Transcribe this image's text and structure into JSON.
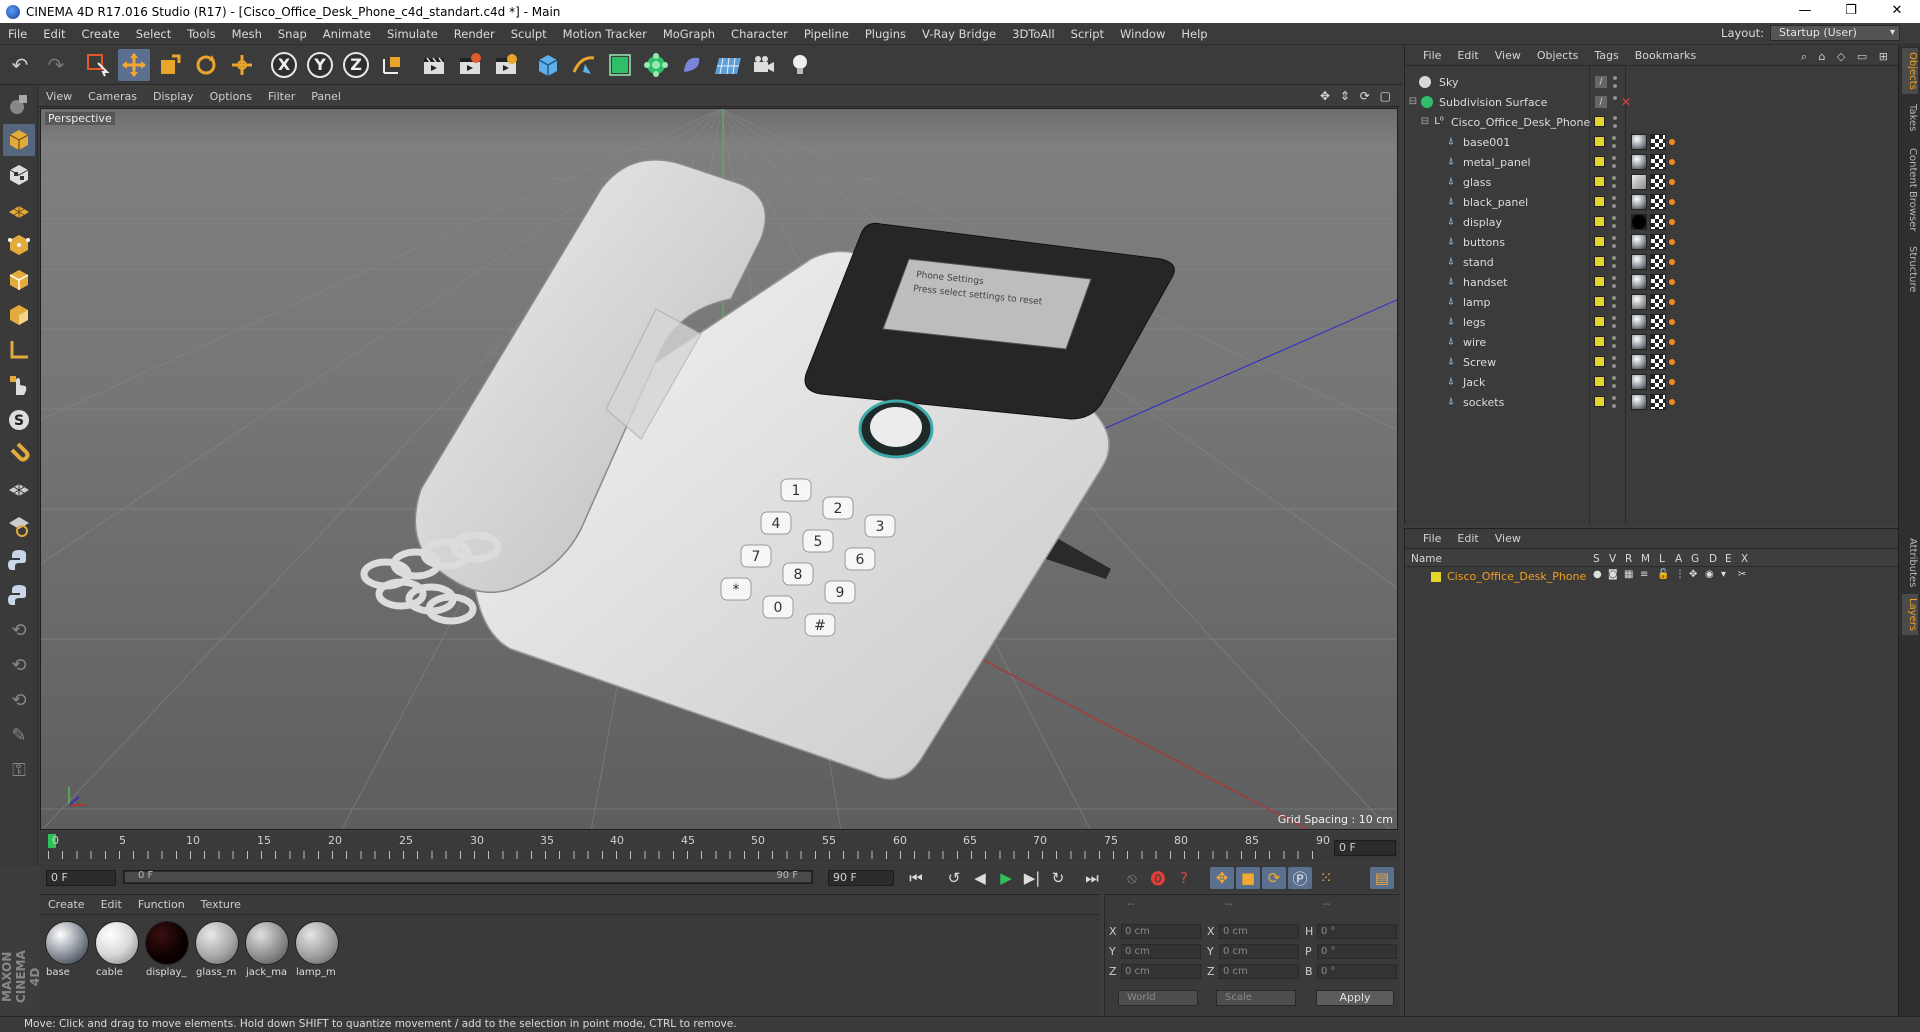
{
  "window": {
    "title": "CINEMA 4D R17.016 Studio (R17) - [Cisco_Office_Desk_Phone_c4d_standart.c4d *] - Main",
    "minimize": "—",
    "maximize": "❐",
    "close": "✕"
  },
  "menu": [
    "File",
    "Edit",
    "Create",
    "Select",
    "Tools",
    "Mesh",
    "Snap",
    "Animate",
    "Simulate",
    "Render",
    "Sculpt",
    "Motion Tracker",
    "MoGraph",
    "Character",
    "Pipeline",
    "Plugins",
    "V-Ray Bridge",
    "3DToAll",
    "Script",
    "Window",
    "Help"
  ],
  "layout": {
    "label": "Layout:",
    "value": "Startup (User)"
  },
  "toolbar": {
    "axis_x": "X",
    "axis_y": "Y",
    "axis_z": "Z"
  },
  "viewport": {
    "menu": [
      "View",
      "Cameras",
      "Display",
      "Options",
      "Filter",
      "Panel"
    ],
    "camera_label": "Perspective",
    "grid_spacing": "Grid Spacing : 10 cm",
    "phone_screen_lines": [
      "Phone Settings",
      "Press select settings to reset"
    ],
    "keys": [
      "1",
      "2",
      "3",
      "4",
      "5",
      "6",
      "7",
      "8",
      "9",
      "*",
      "0",
      "#"
    ]
  },
  "timeline": {
    "ticks": [
      "0",
      "5",
      "10",
      "15",
      "20",
      "25",
      "30",
      "35",
      "40",
      "45",
      "50",
      "55",
      "60",
      "65",
      "70",
      "75",
      "80",
      "85",
      "90"
    ],
    "current_frame": "0 F",
    "start_frame": "0 F",
    "slider_start": "0 F",
    "slider_end": "90 F",
    "end_frame": "90 F"
  },
  "materials": {
    "menu": [
      "Create",
      "Edit",
      "Function",
      "Texture"
    ],
    "items": [
      {
        "name": "base",
        "color": "#9aa0a8"
      },
      {
        "name": "cable",
        "color": "#d9d9d9"
      },
      {
        "name": "display_",
        "color": "#0a0000"
      },
      {
        "name": "glass_m",
        "color": "#a8a8a8"
      },
      {
        "name": "jack_ma",
        "color": "#8e8e8e"
      },
      {
        "name": "lamp_m",
        "color": "#a0a0a0"
      }
    ]
  },
  "coords": {
    "header": [
      "--",
      "--",
      "--"
    ],
    "rows": [
      {
        "a1": "X",
        "v1": "0 cm",
        "a2": "X",
        "v2": "0 cm",
        "a3": "H",
        "v3": "0 °"
      },
      {
        "a1": "Y",
        "v1": "0 cm",
        "a2": "Y",
        "v2": "0 cm",
        "a3": "P",
        "v3": "0 °"
      },
      {
        "a1": "Z",
        "v1": "0 cm",
        "a2": "Z",
        "v2": "0 cm",
        "a3": "B",
        "v3": "0 °"
      }
    ],
    "world": "World",
    "scale": "Scale",
    "apply": "Apply"
  },
  "object_manager": {
    "menu": [
      "File",
      "Edit",
      "View",
      "Objects",
      "Tags",
      "Bookmarks"
    ],
    "objects": [
      {
        "name": "Sky",
        "level": 0,
        "type": "sky"
      },
      {
        "name": "Subdivision Surface",
        "level": 0,
        "type": "subdiv"
      },
      {
        "name": "Cisco_Office_Desk_Phone",
        "level": 1,
        "type": "null"
      },
      {
        "name": "base001",
        "level": 2,
        "type": "poly"
      },
      {
        "name": "metal_panel",
        "level": 2,
        "type": "poly"
      },
      {
        "name": "glass",
        "level": 2,
        "type": "poly"
      },
      {
        "name": "black_panel",
        "level": 2,
        "type": "poly"
      },
      {
        "name": "display",
        "level": 2,
        "type": "poly"
      },
      {
        "name": "buttons",
        "level": 2,
        "type": "poly"
      },
      {
        "name": "stand",
        "level": 2,
        "type": "poly"
      },
      {
        "name": "handset",
        "level": 2,
        "type": "poly"
      },
      {
        "name": "lamp",
        "level": 2,
        "type": "poly"
      },
      {
        "name": "legs",
        "level": 2,
        "type": "poly"
      },
      {
        "name": "wire",
        "level": 2,
        "type": "poly"
      },
      {
        "name": "Screw",
        "level": 2,
        "type": "poly"
      },
      {
        "name": "Jack",
        "level": 2,
        "type": "poly"
      },
      {
        "name": "sockets",
        "level": 2,
        "type": "poly"
      }
    ]
  },
  "layer_manager": {
    "menu": [
      "File",
      "Edit",
      "View"
    ],
    "columns": [
      "Name",
      "S",
      "V",
      "R",
      "M",
      "L",
      "A",
      "G",
      "D",
      "E",
      "X"
    ],
    "layer": {
      "name": "Cisco_Office_Desk_Phone",
      "color": "#e6d52a"
    }
  },
  "right_tabs": [
    "Objects",
    "Takes",
    "Content Browser",
    "Structure",
    "Attributes",
    "Layers"
  ],
  "status": "Move: Click and drag to move elements. Hold down SHIFT to quantize movement / add to the selection in point mode, CTRL to remove.",
  "brand": "MAXON CINEMA 4D",
  "colors": {
    "layer_yellow": "#e6d52a",
    "tag_orange": "#f08a1e",
    "active_blue": "#5b6f8f",
    "play_green": "#2fc15a",
    "layer_name": "#f0a020"
  }
}
